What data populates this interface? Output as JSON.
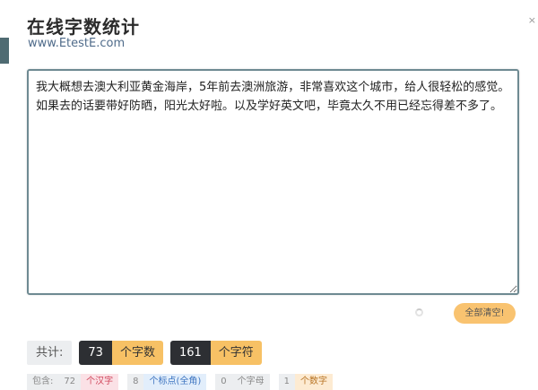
{
  "app": {
    "title": "在线字数统计",
    "site": "www.EtestE.com",
    "corner_mark": "×"
  },
  "editor": {
    "text": "我大概想去澳大利亚黄金海岸，5年前去澳洲旅游，非常喜欢这个城市，给人很轻松的感觉。如果去的话要带好防晒，阳光太好啦。以及学好英文吧，毕竟太久不用已经忘得差不多了。"
  },
  "actions": {
    "clear_label": "全部清空!"
  },
  "stats": {
    "total_label": "共计:",
    "word_count": "73",
    "word_unit": "个字数",
    "char_count": "161",
    "char_unit": "个字符"
  },
  "details": {
    "label": "包含:",
    "items": [
      {
        "count": "72",
        "unit": "个汉字"
      },
      {
        "count": "8",
        "unit": "个标点(全角)"
      },
      {
        "count": "0",
        "unit": "个字母"
      },
      {
        "count": "1",
        "unit": "个数字"
      }
    ]
  },
  "colors": {
    "accent_dark": "#2d2f33",
    "accent_orange": "#f7c165",
    "border": "#6e8a92"
  }
}
